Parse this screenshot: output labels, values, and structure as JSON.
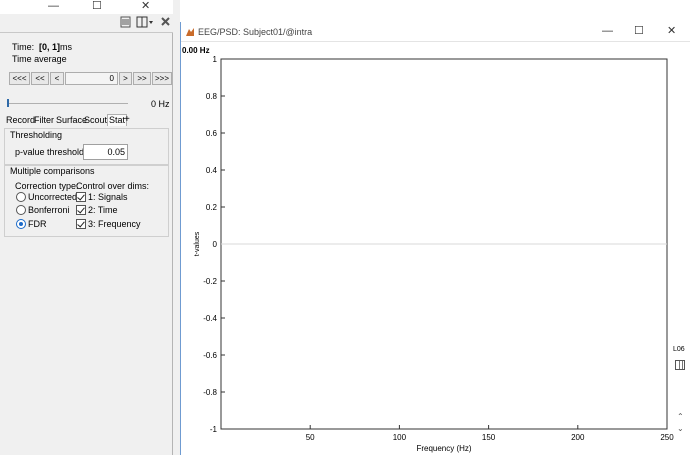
{
  "left_panel": {
    "window": {
      "minimize": "—",
      "maximize": "☐",
      "close": "✕"
    },
    "time_label": "Time:",
    "time_value": "[0, 1]",
    "time_unit": "ms",
    "time_average": "Time average",
    "nav": {
      "first": "<<<",
      "prev_big": "<<",
      "prev": "<",
      "value": "0",
      "next": ">",
      "next_big": ">>",
      "last": ">>>"
    },
    "freq_value": "0 Hz",
    "tabs": [
      "Record",
      "Filter",
      "Surface",
      "Scout",
      "Stat"
    ],
    "tab_add": "+",
    "thresholding": {
      "title": "Thresholding",
      "pvalue_label": "p-value threshold:",
      "pvalue_value": "0.05"
    },
    "multiple_comparisons": {
      "title": "Multiple comparisons",
      "correction_label": "Correction type:",
      "control_label": "Control over dims:",
      "corrections": [
        {
          "label": "Uncorrected",
          "checked": false
        },
        {
          "label": "Bonferroni",
          "checked": false
        },
        {
          "label": "FDR",
          "checked": true
        }
      ],
      "dims": [
        {
          "label": "1: Signals",
          "checked": true
        },
        {
          "label": "2: Time",
          "checked": true
        },
        {
          "label": "3: Frequency",
          "checked": true
        }
      ]
    }
  },
  "figure_window": {
    "title": "EEG/PSD: Subject01/@intra",
    "minimize": "—",
    "maximize": "☐",
    "close": "✕",
    "freq_readout": "0.00 Hz",
    "side_label": "L06"
  },
  "chart_data": {
    "type": "line",
    "title": "",
    "xlabel": "Frequency (Hz)",
    "ylabel": "t-values",
    "xlim": [
      0,
      250
    ],
    "ylim": [
      -1,
      1
    ],
    "x_ticks": [
      50,
      100,
      150,
      200,
      250
    ],
    "y_ticks": [
      1,
      0.8,
      0.6,
      0.4,
      0.2,
      0,
      -0.2,
      -0.4,
      -0.6,
      -0.8,
      -1
    ],
    "series": [
      {
        "x": [
          0,
          250
        ],
        "y": [
          0,
          0
        ],
        "color": "#d9d9d9"
      }
    ],
    "grid": false,
    "line_color": "#d9d9d9"
  }
}
